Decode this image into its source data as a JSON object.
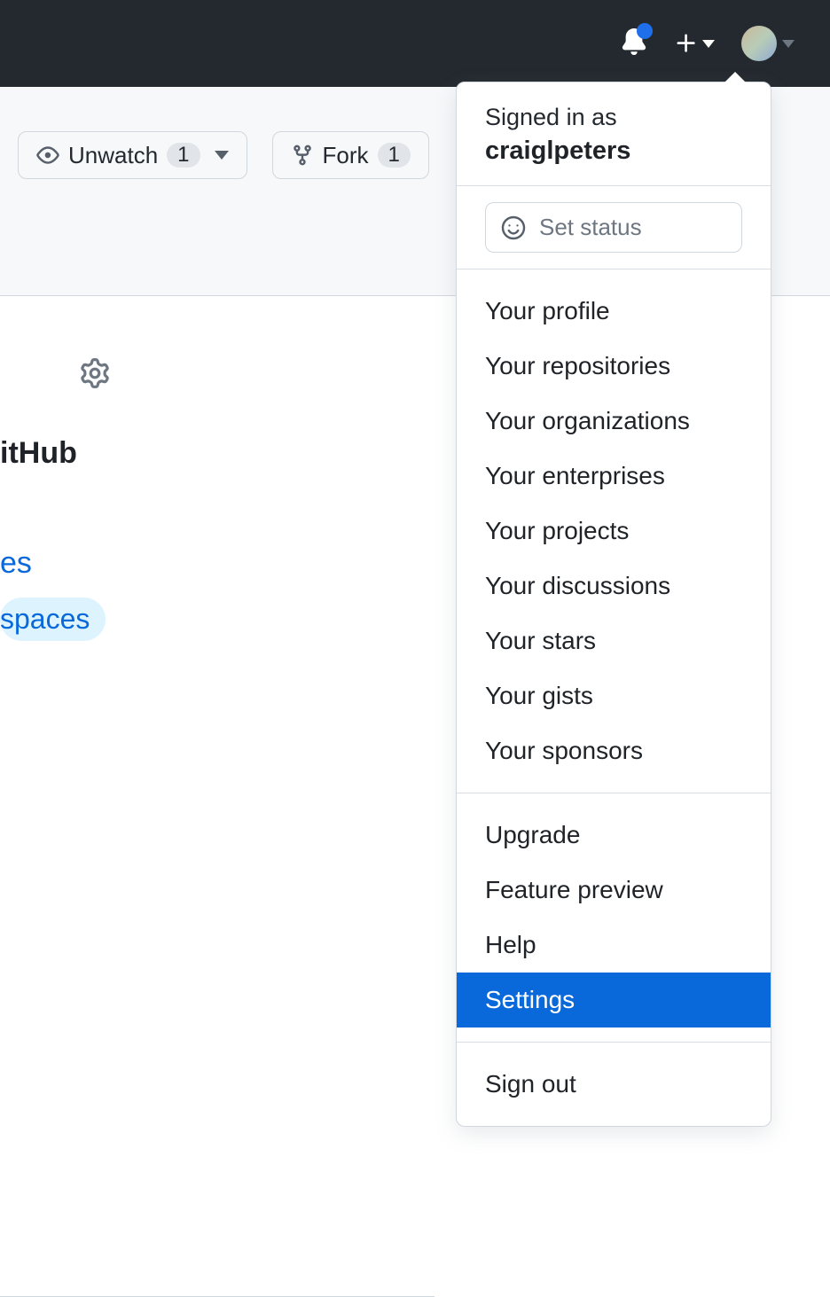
{
  "topbar": {
    "notification_has_unread": true
  },
  "repo_actions": {
    "unwatch": {
      "label": "Unwatch",
      "count": "1"
    },
    "fork": {
      "label": "Fork",
      "count": "1"
    }
  },
  "fragment": {
    "ithub": "itHub",
    "es": "es",
    "spaces": "spaces"
  },
  "dropdown": {
    "signed_in_label": "Signed in as",
    "username": "craiglpeters",
    "set_status_label": "Set status",
    "group1": [
      "Your profile",
      "Your repositories",
      "Your organizations",
      "Your enterprises",
      "Your projects",
      "Your discussions",
      "Your stars",
      "Your gists",
      "Your sponsors"
    ],
    "group2": [
      "Upgrade",
      "Feature preview",
      "Help",
      "Settings"
    ],
    "group3": [
      "Sign out"
    ],
    "selected": "Settings"
  }
}
